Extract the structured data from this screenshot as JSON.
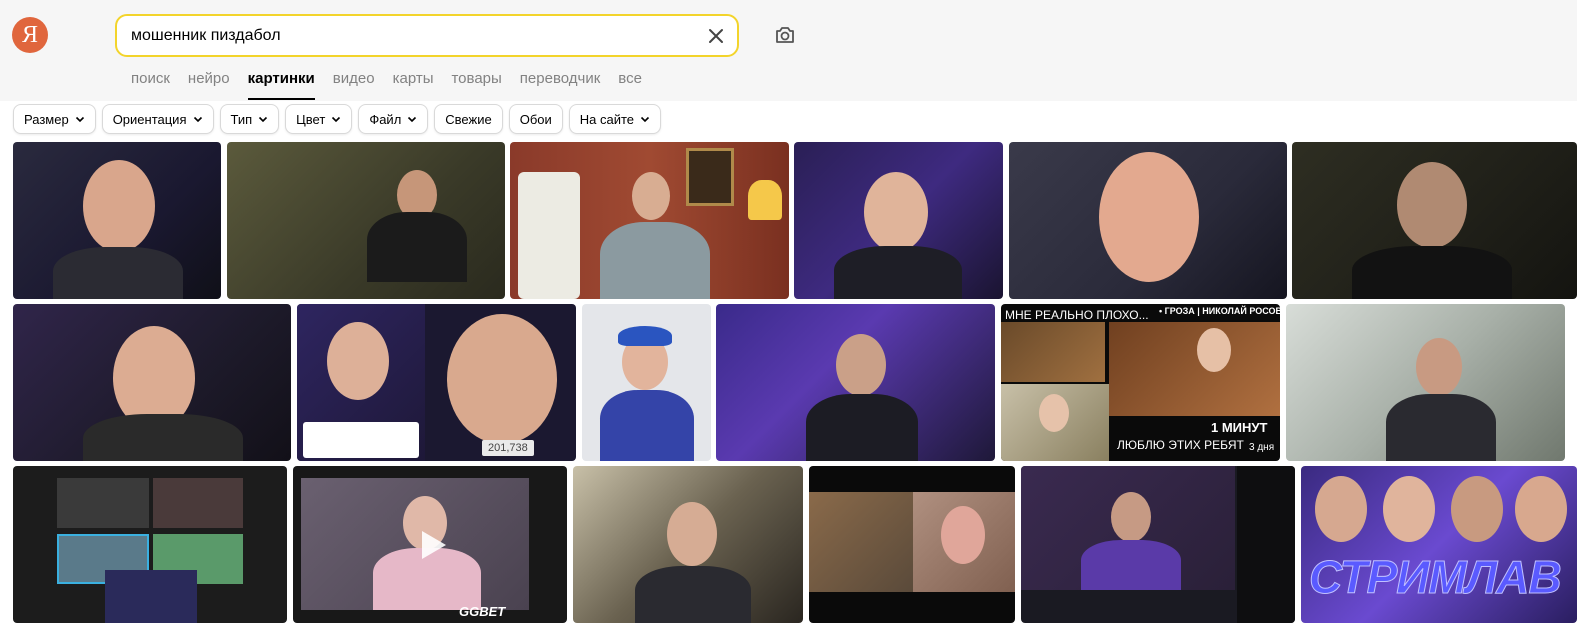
{
  "logo": {
    "letter": "Я",
    "color": "#e0663d"
  },
  "search": {
    "value": "мошенник пиздабол",
    "border_color": "#f3d42b"
  },
  "icons": {
    "clear": "close-icon",
    "camera": "camera-icon"
  },
  "tabs": [
    {
      "label": "поиск",
      "active": false
    },
    {
      "label": "нейро",
      "active": false
    },
    {
      "label": "картинки",
      "active": true
    },
    {
      "label": "видео",
      "active": false
    },
    {
      "label": "карты",
      "active": false
    },
    {
      "label": "товары",
      "active": false
    },
    {
      "label": "переводчик",
      "active": false
    },
    {
      "label": "все",
      "active": false
    }
  ],
  "filters": [
    {
      "label": "Размер",
      "dropdown": true
    },
    {
      "label": "Ориентация",
      "dropdown": true
    },
    {
      "label": "Тип",
      "dropdown": true
    },
    {
      "label": "Цвет",
      "dropdown": true
    },
    {
      "label": "Файл",
      "dropdown": true
    },
    {
      "label": "Свежие",
      "dropdown": false
    },
    {
      "label": "Обои",
      "dropdown": false
    },
    {
      "label": "На сайте",
      "dropdown": true
    }
  ],
  "overlays": {
    "r2t5_top_left": "МНЕ РЕАЛЬНО ПЛОХО...",
    "r2t5_top_right": "• ГРОЗА | НИКОЛАЙ РОСОВ",
    "r2t5_mid": "1 МИНУТ",
    "r2t5_bottom": "ЛЮБЛЮ ЭТИХ РЕБЯТ",
    "r2t5_days": "3 дня",
    "r2t2_count": "201,738",
    "r3t2_brand": "GGBET",
    "r3t6_title": "СТРИМЛАВ"
  }
}
